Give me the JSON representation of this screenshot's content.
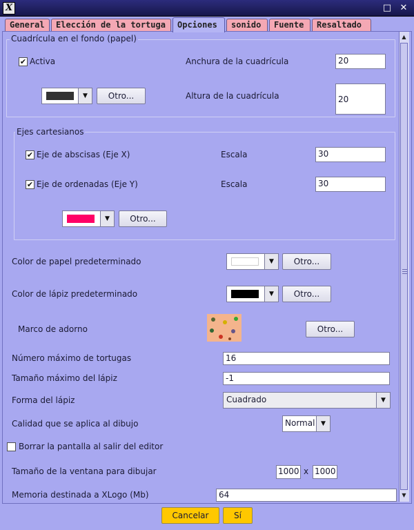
{
  "window": {
    "app_icon_letter": "X",
    "minimize_glyph": "□",
    "close_glyph": "✕"
  },
  "tabs": [
    {
      "label": "General"
    },
    {
      "label": "Elección de la tortuga"
    },
    {
      "label": "Opciones"
    },
    {
      "label": "sonido"
    },
    {
      "label": "Fuente"
    },
    {
      "label": "Resaltado"
    }
  ],
  "active_tab": "Opciones",
  "grid_section": {
    "legend": "Cuadrícula en el fondo (papel)",
    "active_label": "Activa",
    "active_checked": true,
    "check_glyph": "✔",
    "grid_color": "#333333",
    "other_button": "Otro...",
    "width_label": "Anchura de la cuadrícula",
    "width_value": "20",
    "height_label": "Altura de la cuadrícula",
    "height_value": "20"
  },
  "axes_section": {
    "legend": "Ejes cartesianos",
    "x_axis_label": "Eje de abscisas (Eje X)",
    "x_axis_checked": true,
    "x_scale_label": "Escala",
    "x_scale_value": "30",
    "y_axis_label": "Eje de ordenadas (Eje Y)",
    "y_axis_checked": true,
    "y_scale_label": "Escala",
    "y_scale_value": "30",
    "axes_color": "#ff0066",
    "other_button": "Otro..."
  },
  "paper_color": {
    "label": "Color de papel predeterminado",
    "color": "#ffffff",
    "other_button": "Otro..."
  },
  "pen_color": {
    "label": "Color de lápiz predeterminado",
    "color": "#000000",
    "other_button": "Otro..."
  },
  "frame": {
    "label": "Marco de adorno",
    "other_button": "Otro..."
  },
  "max_turtles": {
    "label": "Número máximo de tortugas",
    "value": "16"
  },
  "max_pen_size": {
    "label": "Tamaño máximo del lápiz",
    "value": "-1"
  },
  "pen_shape": {
    "label": "Forma del lápiz",
    "value": "Cuadrado"
  },
  "draw_quality": {
    "label": "Calidad que se aplica al dibujo",
    "value": "Normal"
  },
  "clear_screen": {
    "label": "Borrar la pantalla al salir del editor",
    "checked": false
  },
  "window_size": {
    "label": "Tamaño de la ventana para dibujar",
    "width": "1000",
    "separator": "x",
    "height": "1000"
  },
  "memory": {
    "label": "Memoria destinada a XLogo (Mb)",
    "value": "64"
  },
  "buttons": {
    "cancel": "Cancelar",
    "ok": "Sí"
  },
  "colors": {
    "background": "#a8a8f0",
    "title_bar": "#1e1e5a",
    "tab_inactive": "#f4a8b4",
    "tab_active": "#b4b4f4",
    "button_accent": "#ffc800"
  }
}
